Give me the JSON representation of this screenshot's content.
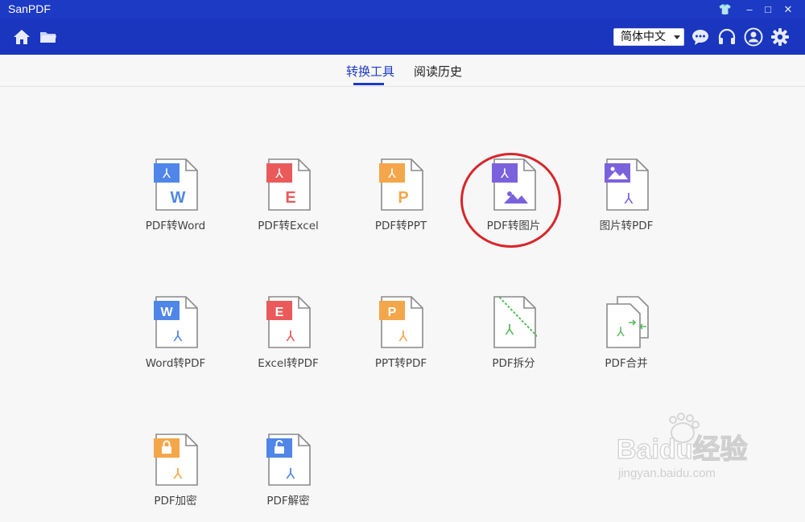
{
  "app": {
    "title": "SanPDF"
  },
  "window_controls": {
    "skin": "👕",
    "minimize": "–",
    "maximize": "□",
    "close": "✕"
  },
  "toolbar": {
    "language": "简体中文",
    "icons": [
      "home-icon",
      "folder-icon",
      "chat-icon",
      "headset-icon",
      "user-icon",
      "gear-icon"
    ]
  },
  "tabs": [
    {
      "label": "转换工具",
      "active": true
    },
    {
      "label": "阅读历史",
      "active": false
    }
  ],
  "tools": [
    {
      "label": "PDF转Word",
      "icon": "pdf-to-word-icon",
      "color": "#4f86e8"
    },
    {
      "label": "PDF转Excel",
      "icon": "pdf-to-excel-icon",
      "color": "#ea5a5a"
    },
    {
      "label": "PDF转PPT",
      "icon": "pdf-to-ppt-icon",
      "color": "#f4a64a"
    },
    {
      "label": "PDF转图片",
      "icon": "pdf-to-image-icon",
      "color": "#7b62dd"
    },
    {
      "label": "图片转PDF",
      "icon": "image-to-pdf-icon",
      "color": "#7b62dd"
    },
    {
      "label": "Word转PDF",
      "icon": "word-to-pdf-icon",
      "color": "#4f86e8"
    },
    {
      "label": "Excel转PDF",
      "icon": "excel-to-pdf-icon",
      "color": "#ea5a5a"
    },
    {
      "label": "PPT转PDF",
      "icon": "ppt-to-pdf-icon",
      "color": "#f4a64a"
    },
    {
      "label": "PDF拆分",
      "icon": "pdf-split-icon",
      "color": "#5bb85b"
    },
    {
      "label": "PDF合并",
      "icon": "pdf-merge-icon",
      "color": "#5bb85b"
    },
    {
      "label": "PDF加密",
      "icon": "pdf-encrypt-icon",
      "color": "#f4a64a"
    },
    {
      "label": "PDF解密",
      "icon": "pdf-decrypt-icon",
      "color": "#4f86e8"
    }
  ],
  "watermark": {
    "brand": "Baidu经验",
    "url": "jingyan.baidu.com"
  }
}
